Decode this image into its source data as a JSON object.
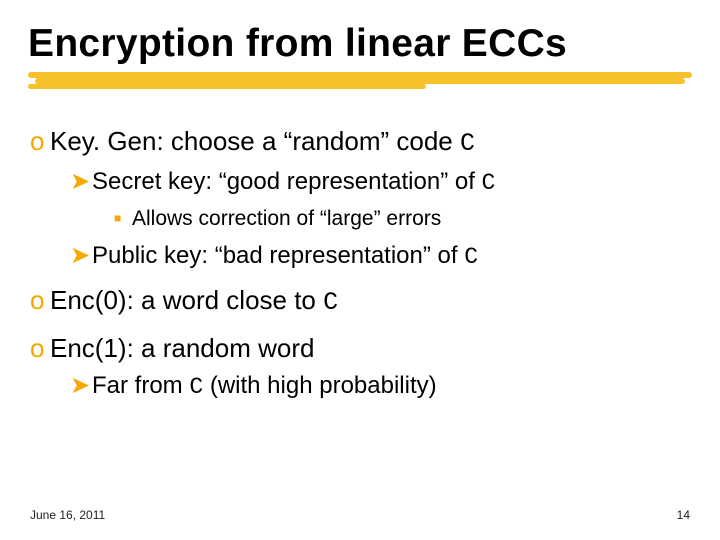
{
  "title": "Encryption from linear ECCs",
  "items": [
    {
      "bullet": "o",
      "parts": [
        "Key. Gen: choose a “random” code ",
        "C"
      ],
      "children": [
        {
          "bullet": "arrow",
          "parts": [
            "Secret key: “good representation” of ",
            "C"
          ],
          "children": [
            {
              "bullet": "sq",
              "parts": [
                "Allows correction of “large” errors"
              ]
            }
          ]
        },
        {
          "bullet": "arrow",
          "parts": [
            "Public key: “bad representation” of ",
            "C"
          ]
        }
      ]
    },
    {
      "bullet": "o",
      "parts": [
        "Enc(0): a word close to ",
        "C"
      ]
    },
    {
      "bullet": "o",
      "parts": [
        "Enc(1): a random word"
      ],
      "children": [
        {
          "bullet": "arrow",
          "parts": [
            "Far from ",
            "C",
            " (with high probability)"
          ]
        }
      ]
    }
  ],
  "footer": {
    "date": "June 16, 2011",
    "page": "14"
  }
}
